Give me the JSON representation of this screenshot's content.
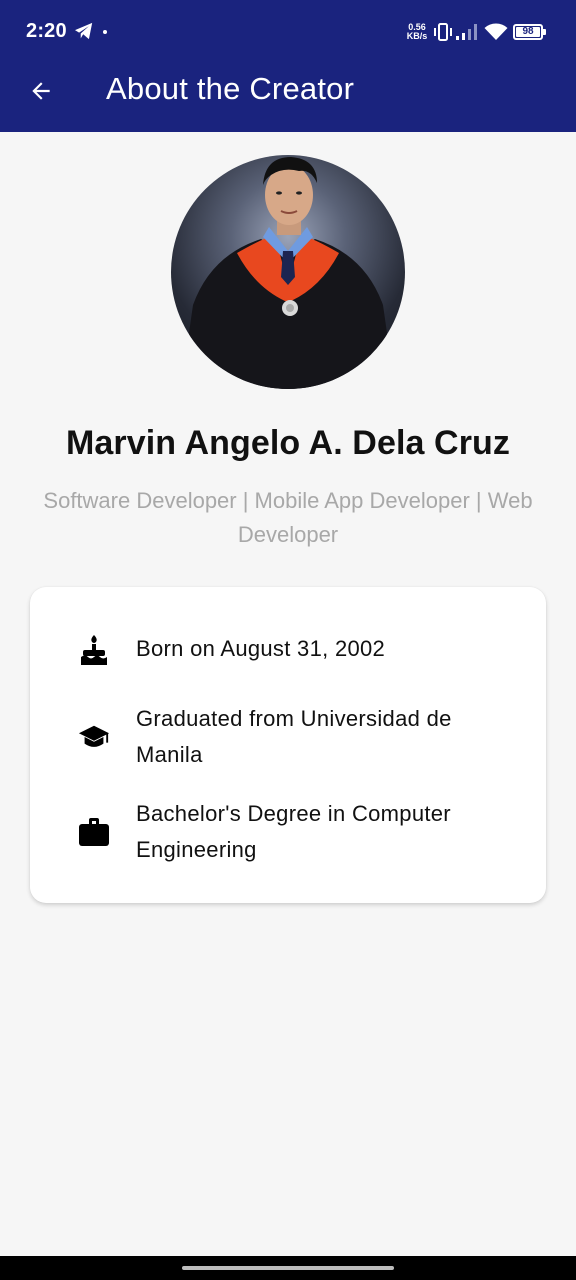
{
  "status_bar": {
    "time": "2:20",
    "net_speed_value": "0.56",
    "net_speed_unit": "KB/s",
    "battery_level": "98",
    "icons": [
      "telegram-icon",
      "vibrate-icon",
      "signal-icon",
      "wifi-icon",
      "battery-icon"
    ]
  },
  "app_bar": {
    "title": "About the Creator",
    "back_icon": "arrow-back-icon",
    "background_color": "#1a237e"
  },
  "profile": {
    "name": "Marvin Angelo A. Dela Cruz",
    "role": "Software Developer | Mobile App Developer | Web Developer"
  },
  "info": {
    "items": [
      {
        "icon": "cake-icon",
        "text": "Born on August 31, 2002"
      },
      {
        "icon": "graduation-cap-icon",
        "text": "Graduated from Universidad de Manila"
      },
      {
        "icon": "briefcase-icon",
        "text": "Bachelor's Degree in Computer Engineering"
      }
    ]
  }
}
